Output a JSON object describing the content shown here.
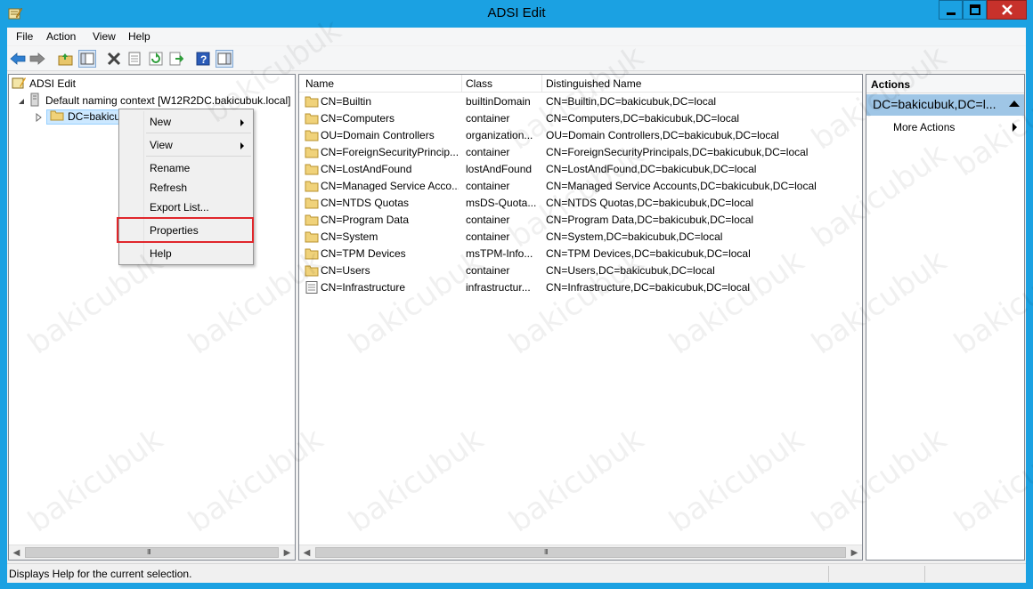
{
  "window": {
    "title": "ADSI Edit"
  },
  "menubar": {
    "items": [
      "File",
      "Action",
      "View",
      "Help"
    ]
  },
  "toolbar": {
    "icons": [
      "back-arrow-icon",
      "forward-arrow-icon",
      "up-folder-icon",
      "show-hide-tree-icon",
      "delete-icon",
      "properties-icon",
      "refresh-icon",
      "export-list-icon",
      "help-icon",
      "show-action-pane-icon"
    ]
  },
  "tree": {
    "root": "ADSI Edit",
    "context": "Default naming context [W12R2DC.bakicubuk.local]",
    "selected": "DC=bakicu"
  },
  "list": {
    "headers": {
      "name": "Name",
      "class": "Class",
      "dn": "Distinguished Name"
    },
    "rows": [
      {
        "name": "CN=Builtin",
        "class": "builtinDomain",
        "dn": "CN=Builtin,DC=bakicubuk,DC=local",
        "icon": "folder-icon"
      },
      {
        "name": "CN=Computers",
        "class": "container",
        "dn": "CN=Computers,DC=bakicubuk,DC=local",
        "icon": "folder-icon"
      },
      {
        "name": "OU=Domain Controllers",
        "class": "organization...",
        "dn": "OU=Domain Controllers,DC=bakicubuk,DC=local",
        "icon": "folder-icon"
      },
      {
        "name": "CN=ForeignSecurityPrincip...",
        "class": "container",
        "dn": "CN=ForeignSecurityPrincipals,DC=bakicubuk,DC=local",
        "icon": "folder-icon"
      },
      {
        "name": "CN=LostAndFound",
        "class": "lostAndFound",
        "dn": "CN=LostAndFound,DC=bakicubuk,DC=local",
        "icon": "folder-icon"
      },
      {
        "name": "CN=Managed Service Acco...",
        "class": "container",
        "dn": "CN=Managed Service Accounts,DC=bakicubuk,DC=local",
        "icon": "folder-icon"
      },
      {
        "name": "CN=NTDS Quotas",
        "class": "msDS-Quota...",
        "dn": "CN=NTDS Quotas,DC=bakicubuk,DC=local",
        "icon": "folder-icon"
      },
      {
        "name": "CN=Program Data",
        "class": "container",
        "dn": "CN=Program Data,DC=bakicubuk,DC=local",
        "icon": "folder-icon"
      },
      {
        "name": "CN=System",
        "class": "container",
        "dn": "CN=System,DC=bakicubuk,DC=local",
        "icon": "folder-icon"
      },
      {
        "name": "CN=TPM Devices",
        "class": "msTPM-Info...",
        "dn": "CN=TPM Devices,DC=bakicubuk,DC=local",
        "icon": "folder-icon"
      },
      {
        "name": "CN=Users",
        "class": "container",
        "dn": "CN=Users,DC=bakicubuk,DC=local",
        "icon": "folder-icon"
      },
      {
        "name": "CN=Infrastructure",
        "class": "infrastructur...",
        "dn": "CN=Infrastructure,DC=bakicubuk,DC=local",
        "icon": "document-icon"
      }
    ]
  },
  "actions": {
    "title": "Actions",
    "selected": "DC=bakicubuk,DC=l...",
    "more": "More Actions"
  },
  "context_menu": {
    "new": "New",
    "view": "View",
    "rename": "Rename",
    "refresh": "Refresh",
    "export": "Export List...",
    "properties": "Properties",
    "help": "Help"
  },
  "status": {
    "text": "Displays Help for the current selection."
  },
  "watermark": "bakicubuk",
  "colors": {
    "titlebar": "#1ba1e2",
    "highlight": "#e0262b",
    "selection": "#9fc6e6",
    "close": "#c7312b"
  }
}
